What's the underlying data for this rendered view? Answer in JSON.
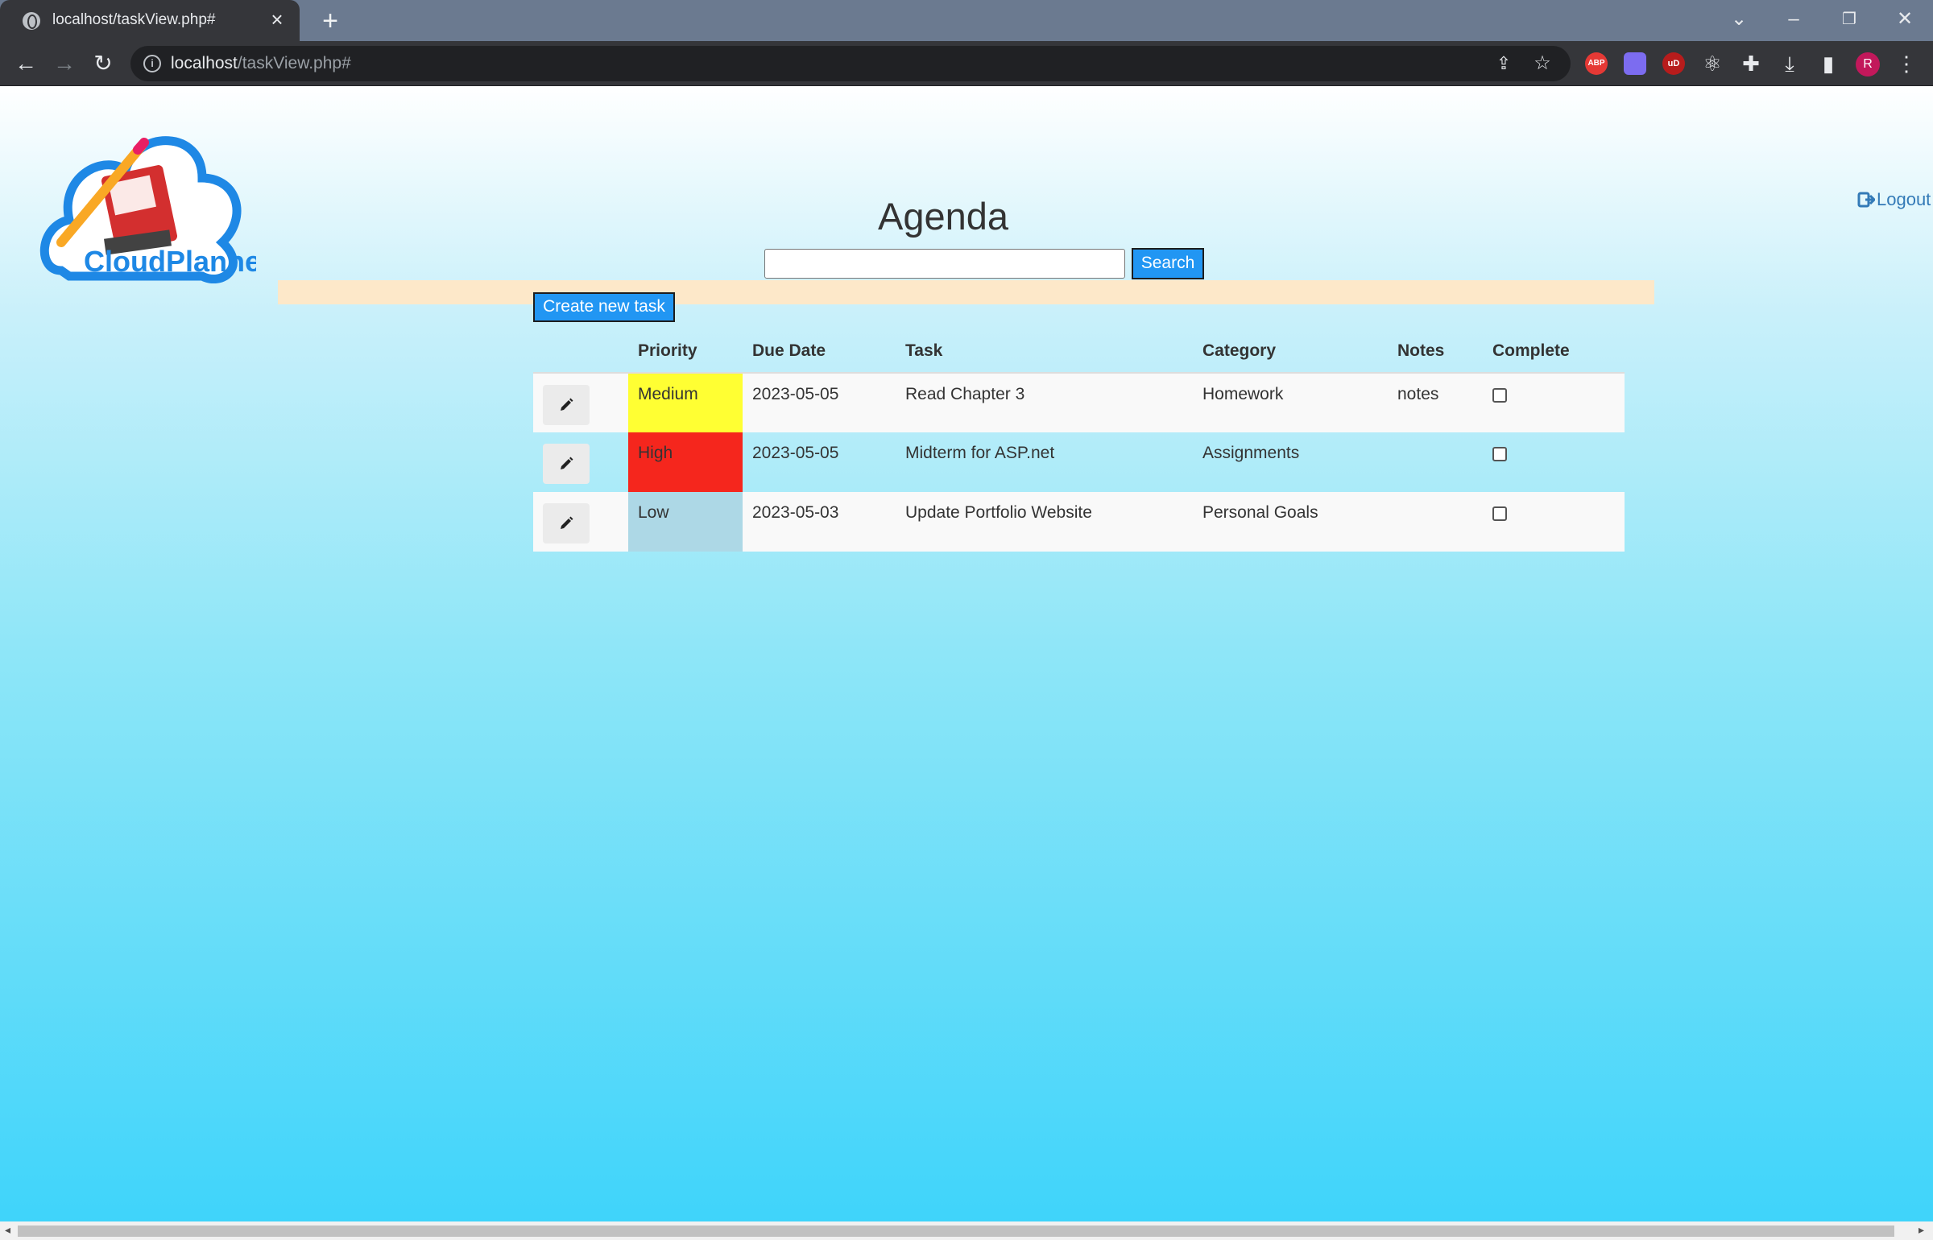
{
  "browser": {
    "tab_title": "localhost/taskView.php#",
    "url_host": "localhost",
    "url_path": "/taskView.php#",
    "avatar_letter": "R",
    "extensions": [
      "ABP",
      "ext-blue",
      "uD",
      "react-devtools-icon",
      "puzzle-icon"
    ]
  },
  "header": {
    "logo_text": "CloudPlanner",
    "logout_label": "Logout",
    "title": "Agenda"
  },
  "search": {
    "value": "",
    "button_label": "Search"
  },
  "create_button_label": "Create new task",
  "table": {
    "columns": [
      "",
      "Priority",
      "Due Date",
      "Task",
      "Category",
      "Notes",
      "Complete"
    ],
    "rows": [
      {
        "priority": "Medium",
        "priority_color": "#ffff33",
        "due_date": "2023-05-05",
        "task": "Read Chapter 3",
        "category": "Homework",
        "notes": "notes",
        "complete": false
      },
      {
        "priority": "High",
        "priority_color": "#f5261d",
        "due_date": "2023-05-05",
        "task": "Midterm for ASP.net",
        "category": "Assignments",
        "notes": "",
        "complete": false
      },
      {
        "priority": "Low",
        "priority_color": "#add8e6",
        "due_date": "2023-05-03",
        "task": "Update Portfolio Website",
        "category": "Personal Goals",
        "notes": "",
        "complete": false
      }
    ]
  },
  "colors": {
    "button_blue": "#2196f3",
    "band": "#fde8c9",
    "link": "#337ab7"
  }
}
